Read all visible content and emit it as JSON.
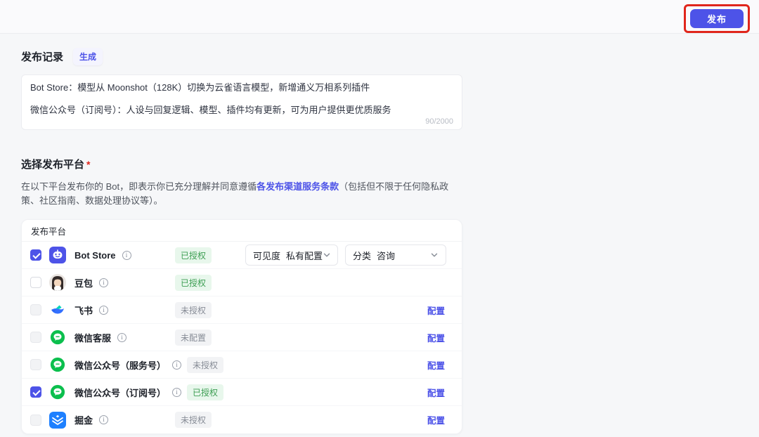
{
  "topbar": {
    "publish_button_label": "发布"
  },
  "publish_record": {
    "title": "发布记录",
    "generate_button_label": "生成",
    "note_line1": "Bot Store：模型从 Moonshot（128K）切换为云雀语言模型，新增通义万相系列插件",
    "note_line2": "微信公众号（订阅号）：人设与回复逻辑、模型、插件均有更新，可为用户提供更优质服务",
    "char_counter": "90/2000"
  },
  "platform_section": {
    "title": "选择发布平台",
    "required_mark": "*",
    "desc_prefix": "在以下平台发布你的 Bot，即表示你已充分理解并同意遵循",
    "terms_link_label": "各发布渠道服务条款",
    "desc_suffix": "（包括但不限于任何隐私政策、社区指南、数据处理协议等）。",
    "table_header": "发布平台",
    "platforms": [
      {
        "name": "Bot Store",
        "checkbox": "checked",
        "badge": "已授权",
        "badge_type": "success",
        "visibility_dropdown": {
          "label": "可见度",
          "value": "私有配置"
        },
        "category_dropdown": {
          "label": "分类",
          "value": "咨询"
        }
      },
      {
        "name": "豆包",
        "checkbox": "unchecked",
        "badge": "已授权",
        "badge_type": "success"
      },
      {
        "name": "飞书",
        "checkbox": "disabled",
        "badge": "未授权",
        "badge_type": "neutral",
        "action": "配置"
      },
      {
        "name": "微信客服",
        "checkbox": "disabled",
        "badge": "未配置",
        "badge_type": "neutral",
        "action": "配置"
      },
      {
        "name": "微信公众号（服务号）",
        "checkbox": "disabled",
        "badge": "未授权",
        "badge_type": "neutral",
        "action": "配置"
      },
      {
        "name": "微信公众号（订阅号）",
        "checkbox": "checked",
        "badge": "已授权",
        "badge_type": "success",
        "action": "配置"
      },
      {
        "name": "掘金",
        "checkbox": "disabled",
        "badge": "未授权",
        "badge_type": "neutral",
        "action": "配置"
      }
    ]
  },
  "colors": {
    "accent": "#4D53E8",
    "annotation_red": "#E0261C",
    "success_text": "#3C9E52",
    "success_bg": "#E8F7EC",
    "neutral_text": "#878C96",
    "neutral_bg": "#F2F3F5",
    "feishu_blue": "#3370FF",
    "feishu_teal": "#00D6B9",
    "wechat_green": "#0BBF4D",
    "juejin_blue": "#1E80FF"
  }
}
